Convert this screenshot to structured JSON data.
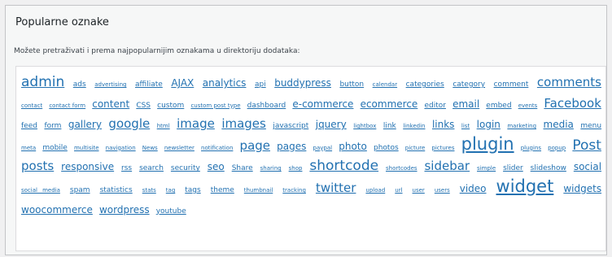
{
  "header": {
    "title": "Popularne oznake",
    "description": "Možete pretraživati i prema najpopularnijim oznakama u direktoriju dodataka:"
  },
  "tags": [
    {
      "label": "admin",
      "size": 4
    },
    {
      "label": "ads",
      "size": 1
    },
    {
      "label": "advertising",
      "size": 0
    },
    {
      "label": "affiliate",
      "size": 1
    },
    {
      "label": "AJAX",
      "size": 2
    },
    {
      "label": "analytics",
      "size": 2
    },
    {
      "label": "api",
      "size": 1
    },
    {
      "label": "buddypress",
      "size": 2
    },
    {
      "label": "button",
      "size": 1
    },
    {
      "label": "calendar",
      "size": 0
    },
    {
      "label": "categories",
      "size": 1
    },
    {
      "label": "category",
      "size": 1
    },
    {
      "label": "comment",
      "size": 1
    },
    {
      "label": "comments",
      "size": 3
    },
    {
      "label": "contact",
      "size": 0
    },
    {
      "label": "contact form",
      "size": 0
    },
    {
      "label": "content",
      "size": 2
    },
    {
      "label": "CSS",
      "size": 1
    },
    {
      "label": "custom",
      "size": 1
    },
    {
      "label": "custom post type",
      "size": 0
    },
    {
      "label": "dashboard",
      "size": 1
    },
    {
      "label": "e-commerce",
      "size": 2
    },
    {
      "label": "ecommerce",
      "size": 2
    },
    {
      "label": "editor",
      "size": 1
    },
    {
      "label": "email",
      "size": 2
    },
    {
      "label": "embed",
      "size": 1
    },
    {
      "label": "events",
      "size": 0
    },
    {
      "label": "Facebook",
      "size": 3
    },
    {
      "label": "feed",
      "size": 1
    },
    {
      "label": "form",
      "size": 1
    },
    {
      "label": "gallery",
      "size": 2
    },
    {
      "label": "google",
      "size": 3
    },
    {
      "label": "html",
      "size": 0
    },
    {
      "label": "image",
      "size": 3
    },
    {
      "label": "images",
      "size": 3
    },
    {
      "label": "javascript",
      "size": 1
    },
    {
      "label": "jquery",
      "size": 2
    },
    {
      "label": "lightbox",
      "size": 0
    },
    {
      "label": "link",
      "size": 1
    },
    {
      "label": "linkedin",
      "size": 0
    },
    {
      "label": "links",
      "size": 2
    },
    {
      "label": "list",
      "size": 0
    },
    {
      "label": "login",
      "size": 2
    },
    {
      "label": "marketing",
      "size": 0
    },
    {
      "label": "media",
      "size": 2
    },
    {
      "label": "menu",
      "size": 1
    },
    {
      "label": "meta",
      "size": 0
    },
    {
      "label": "mobile",
      "size": 1
    },
    {
      "label": "multisite",
      "size": 0
    },
    {
      "label": "navigation",
      "size": 0
    },
    {
      "label": "News",
      "size": 0
    },
    {
      "label": "newsletter",
      "size": 0
    },
    {
      "label": "notification",
      "size": 0
    },
    {
      "label": "page",
      "size": 3
    },
    {
      "label": "pages",
      "size": 2
    },
    {
      "label": "paypal",
      "size": 0
    },
    {
      "label": "photo",
      "size": 2
    },
    {
      "label": "photos",
      "size": 1
    },
    {
      "label": "picture",
      "size": 0
    },
    {
      "label": "pictures",
      "size": 0
    },
    {
      "label": "plugin",
      "size": 5
    },
    {
      "label": "plugins",
      "size": 0
    },
    {
      "label": "popup",
      "size": 0
    },
    {
      "label": "Post",
      "size": 4
    },
    {
      "label": "posts",
      "size": 3
    },
    {
      "label": "responsive",
      "size": 2
    },
    {
      "label": "rss",
      "size": 1
    },
    {
      "label": "search",
      "size": 1
    },
    {
      "label": "security",
      "size": 1
    },
    {
      "label": "seo",
      "size": 2
    },
    {
      "label": "Share",
      "size": 1
    },
    {
      "label": "sharing",
      "size": 0
    },
    {
      "label": "shop",
      "size": 0
    },
    {
      "label": "shortcode",
      "size": 4
    },
    {
      "label": "shortcodes",
      "size": 0
    },
    {
      "label": "sidebar",
      "size": 3
    },
    {
      "label": "simple",
      "size": 0
    },
    {
      "label": "slider",
      "size": 1
    },
    {
      "label": "slideshow",
      "size": 1
    },
    {
      "label": "social",
      "size": 2
    },
    {
      "label": "social media",
      "size": 0
    },
    {
      "label": "spam",
      "size": 1
    },
    {
      "label": "statistics",
      "size": 1
    },
    {
      "label": "stats",
      "size": 0
    },
    {
      "label": "tag",
      "size": 0
    },
    {
      "label": "tags",
      "size": 1
    },
    {
      "label": "theme",
      "size": 1
    },
    {
      "label": "thumbnail",
      "size": 0
    },
    {
      "label": "tracking",
      "size": 0
    },
    {
      "label": "twitter",
      "size": 3
    },
    {
      "label": "upload",
      "size": 0
    },
    {
      "label": "url",
      "size": 0
    },
    {
      "label": "user",
      "size": 0
    },
    {
      "label": "users",
      "size": 0
    },
    {
      "label": "video",
      "size": 2
    },
    {
      "label": "widget",
      "size": 5
    },
    {
      "label": "widgets",
      "size": 2
    },
    {
      "label": "woocommerce",
      "size": 2
    },
    {
      "label": "wordpress",
      "size": 2
    },
    {
      "label": "youtube",
      "size": 1
    }
  ],
  "colors": {
    "link": "#2271b1",
    "text": "#1d2327"
  }
}
